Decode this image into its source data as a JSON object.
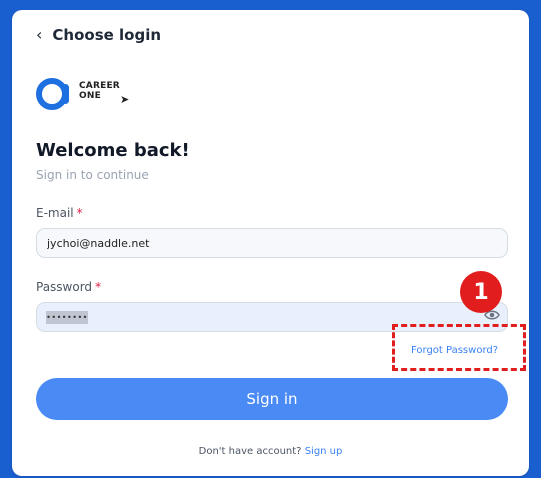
{
  "header": {
    "back_label": "Choose login",
    "back_icon": "chevron-left-icon"
  },
  "logo": {
    "line1": "CAREER",
    "line2": "ONE",
    "brand_color": "#1e6fe0"
  },
  "welcome": {
    "title": "Welcome back!",
    "subtitle": "Sign in to continue"
  },
  "email": {
    "label": "E-mail",
    "required_mark": "*",
    "value": "jychoi@naddle.net"
  },
  "password": {
    "label": "Password",
    "required_mark": "*",
    "masked_value": "••••••••"
  },
  "forgot_label": "Forgot Password?",
  "signin_label": "Sign in",
  "footer": {
    "prompt": "Don't have account?",
    "link": "Sign up"
  },
  "annotation": {
    "number": "1",
    "color": "#e11d1d"
  },
  "colors": {
    "accent": "#4a8af4",
    "link": "#3b82f6",
    "required": "#e11d48"
  }
}
